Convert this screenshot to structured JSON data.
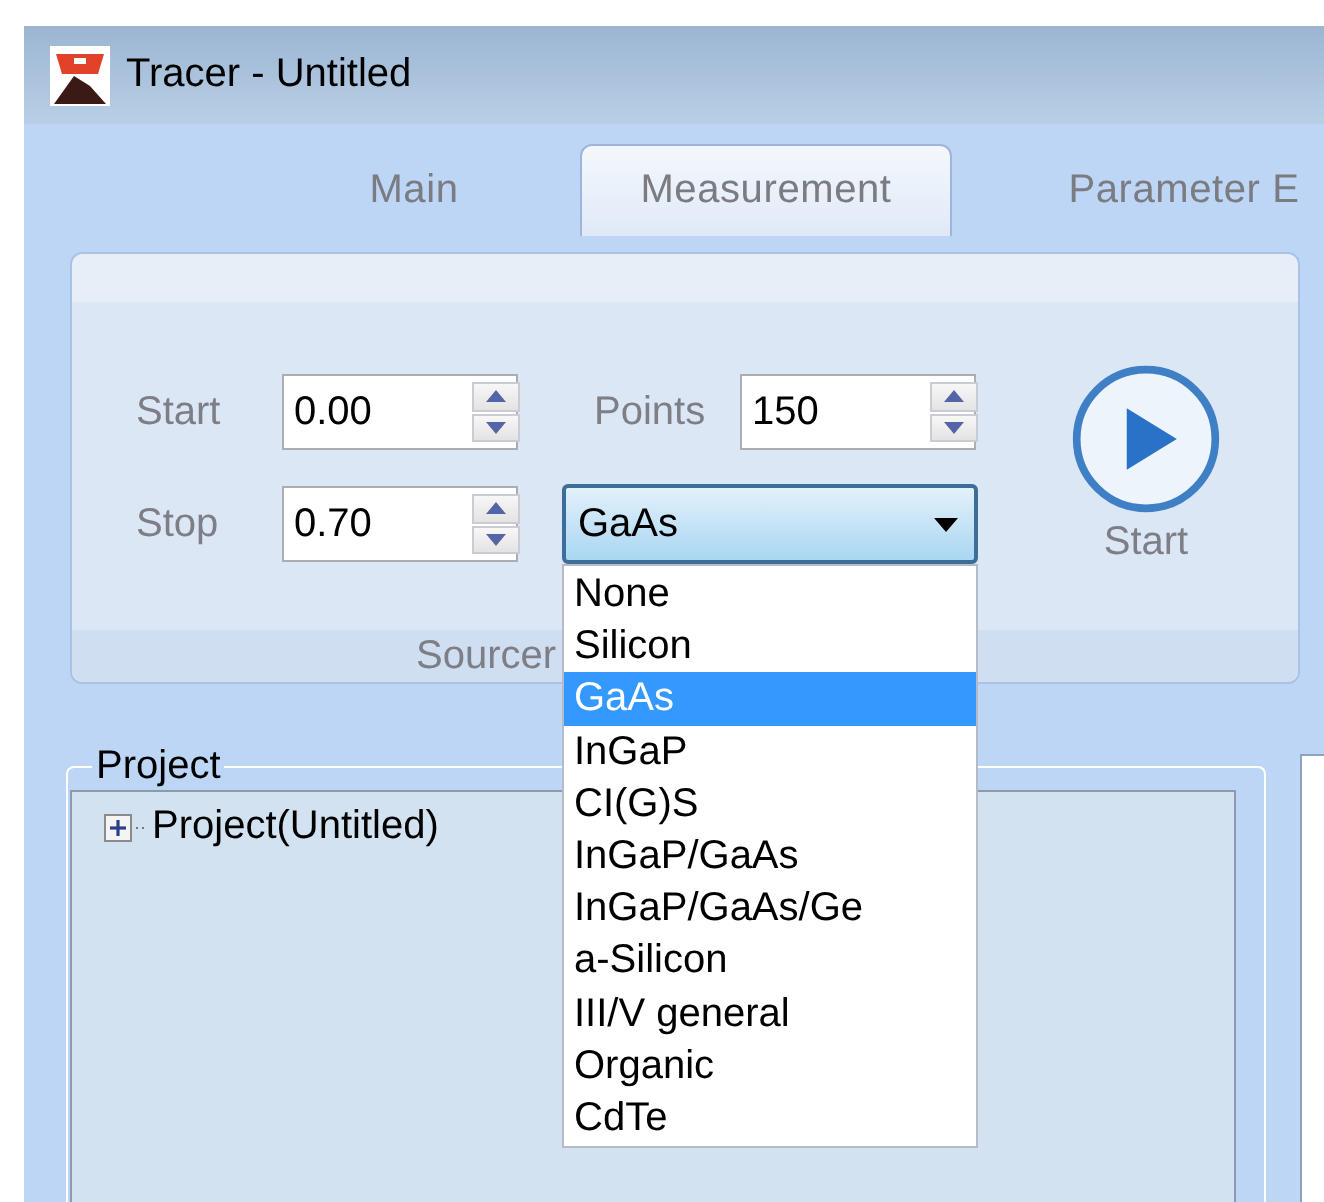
{
  "window": {
    "title": "Tracer - Untitled"
  },
  "tabs": [
    {
      "label": "Main",
      "selected": false
    },
    {
      "label": "Measurement",
      "selected": true
    },
    {
      "label": "Parameter E",
      "selected": false
    }
  ],
  "source_group": {
    "label": "Sourcer",
    "fields": [
      {
        "label": "Start",
        "value": "0.00"
      },
      {
        "label": "Points",
        "value": "150"
      },
      {
        "label": "Stop",
        "value": "0.70"
      }
    ],
    "cell_type": {
      "value": "GaAs",
      "expanded": true,
      "options": [
        {
          "label": "None",
          "selected": false
        },
        {
          "label": "Silicon",
          "selected": false
        },
        {
          "label": "GaAs",
          "selected": true
        },
        {
          "label": "InGaP",
          "selected": false
        },
        {
          "label": "CI(G)S",
          "selected": false
        },
        {
          "label": "InGaP/GaAs",
          "selected": false
        },
        {
          "label": "InGaP/GaAs/Ge",
          "selected": false
        },
        {
          "label": "a-Silicon",
          "selected": false
        },
        {
          "label": "III/V general",
          "selected": false
        },
        {
          "label": "Organic",
          "selected": false
        },
        {
          "label": "CdTe",
          "selected": false
        }
      ]
    },
    "start_button": "Start"
  },
  "project": {
    "label": "Project",
    "tree": [
      {
        "label": "Project(Untitled)",
        "expanded": false
      }
    ]
  }
}
